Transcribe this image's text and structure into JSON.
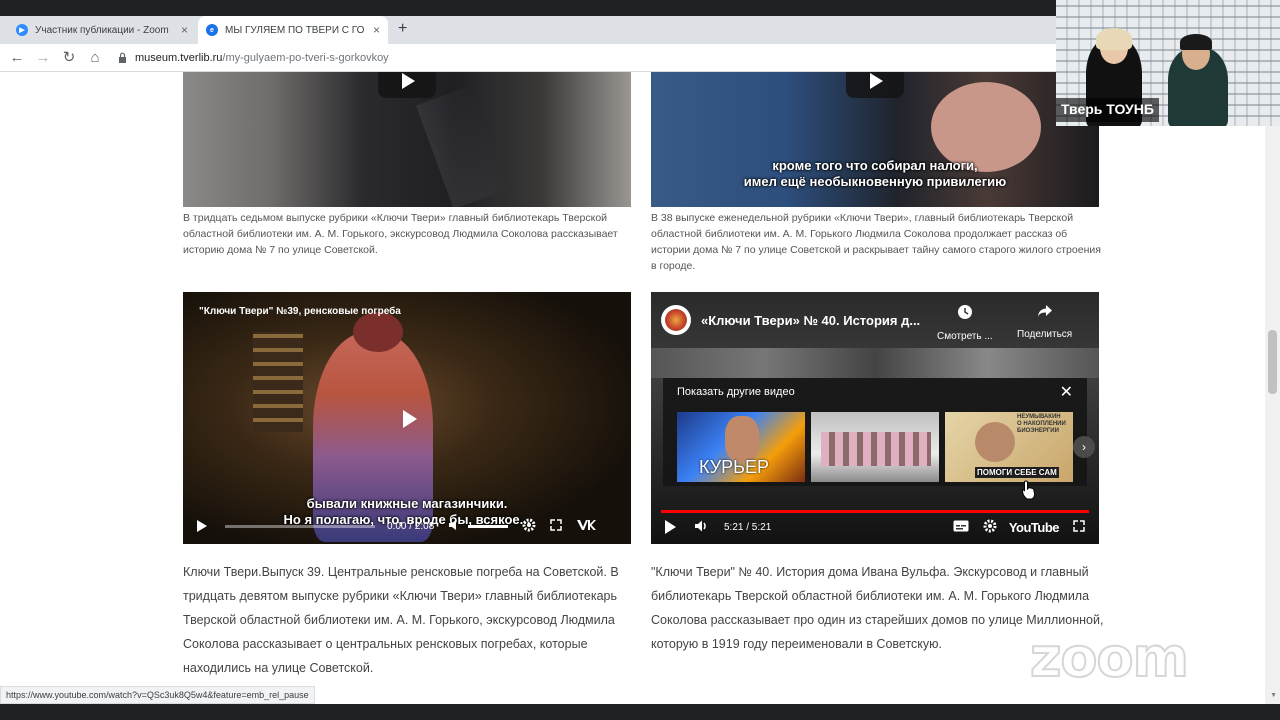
{
  "browser": {
    "tabs": [
      {
        "title": "Участник публикации - Zoom",
        "close": "×",
        "icon": "zoom-icon"
      },
      {
        "title": "МЫ ГУЛЯЕМ ПО ТВЕРИ С ГО",
        "close": "×",
        "icon": "site-icon"
      }
    ],
    "new_tab": "+",
    "url_domain": "museum.tverlib.ru",
    "url_path": "/my-gulyaem-po-tveri-s-gorkovkoy",
    "back": "←",
    "forward": "→",
    "reload": "↻",
    "home": "⌂",
    "lock": "🔒",
    "status_link": "https://www.youtube.com/watch?v=QSc3uk8Q5w4&feature=emb_rel_pause"
  },
  "videos": {
    "v1": {
      "caption": "В тридцать седьмом выпуске рубрики «Ключи Твери» главный библиотекарь Тверской областной библиотеки им. А. М. Горького, экскурсовод Людмила Соколова рассказывает историю дома № 7 по улице Советской."
    },
    "v2": {
      "subtitle": "кроме того что собирал налоги,\nимел ещё необыкновенную привилегию",
      "caption": " В 38 выпуске еженедельной рубрики «Ключи Твери»,  главный библиотекарь Тверской областной библиотеки им. А. М. Горького Людмила Соколова продолжает рассказ об истории дома № 7 по улице Советской и раскрывает тайну самого старого жилого строения в городе."
    },
    "v3": {
      "title": "\"Ключи Твери\" №39, ренсковые погреба",
      "subtitle": "бывали книжные магазинчики.\nНо я полагаю, что, вроде бы, всякое...",
      "time": "0:00 / 2:08",
      "desc": "Ключи Твери.Выпуск 39. Центральные ренсковые погреба на Советской. В тридцать девятом выпуске рубрики «Ключи Твери» главный библиотекарь Тверской областной библиотеки им. А. М. Горького, экскурсовод Людмила Соколова рассказывает о центральных ренсковых погребах, которые находились на улице Советской."
    },
    "v4": {
      "title": "«Ключи Твери» № 40. История д...",
      "watch_later": "Смотреть ...",
      "share": "Поделиться",
      "more_videos": "Показать другие видео",
      "more_close": "✕",
      "thumb1_label": "КУРЬЕР",
      "thumb3_label": "ПОМОГИ СЕБЕ САМ",
      "thumb3_top": "НЕУМЫВАКИН\nО НАКОПЛЕНИИ\nБИОЭНЕРГИИ",
      "next": "›",
      "time": "5:21 / 5:21",
      "logo": "YouTube",
      "desc": "\"Ключи Твери\" № 40. История дома Ивана Вульфа. Экскурсовод и главный библиотекарь Тверской областной библиотеки им. А. М. Горького Людмила Соколова рассказывает про один из старейших домов по улице Миллионной, которую в 1919 году переименовали в Советскую."
    }
  },
  "zoom": {
    "participant_name": "Тверь ТОУНБ",
    "watermark": "zoom"
  },
  "colors": {
    "zoom_blue": "#2d8cff",
    "site_blue": "#1a73e8",
    "youtube_red": "#ff0000"
  }
}
